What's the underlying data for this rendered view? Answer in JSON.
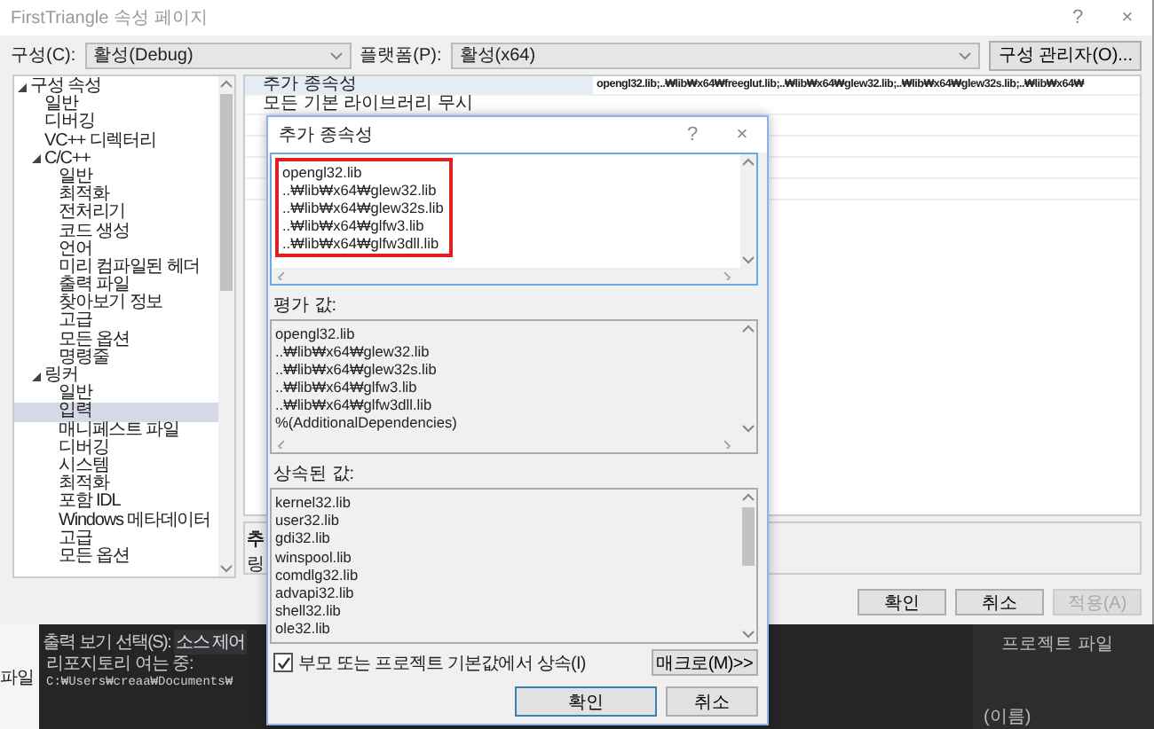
{
  "window": {
    "title": "FirstTriangle 속성 페이지",
    "help": "?",
    "close": "×"
  },
  "config": {
    "configuration_label": "구성(C):",
    "configuration": "활성(Debug)",
    "platform_label": "플랫폼(P):",
    "platform": "활성(x64)",
    "manager_button": "구성 관리자(O)..."
  },
  "tree": [
    {
      "label": "구성 속성",
      "expanded": true,
      "selected": false,
      "children": [
        {
          "label": "일반",
          "selected": false
        },
        {
          "label": "디버깅",
          "selected": false
        },
        {
          "label": "VC++ 디렉터리",
          "selected": false
        },
        {
          "label": "C/C++",
          "expanded": true,
          "selected": false,
          "children": [
            {
              "label": "일반",
              "selected": false
            },
            {
              "label": "최적화",
              "selected": false
            },
            {
              "label": "전처리기",
              "selected": false
            },
            {
              "label": "코드 생성",
              "selected": false
            },
            {
              "label": "언어",
              "selected": false
            },
            {
              "label": "미리 컴파일된 헤더",
              "selected": false
            },
            {
              "label": "출력 파일",
              "selected": false
            },
            {
              "label": "찾아보기 정보",
              "selected": false
            },
            {
              "label": "고급",
              "selected": false
            },
            {
              "label": "모든 옵션",
              "selected": false
            },
            {
              "label": "명령줄",
              "selected": false
            }
          ]
        },
        {
          "label": "링커",
          "expanded": true,
          "selected": false,
          "children": [
            {
              "label": "일반",
              "selected": false
            },
            {
              "label": "입력",
              "selected": true
            },
            {
              "label": "매니페스트 파일",
              "selected": false
            },
            {
              "label": "디버깅",
              "selected": false
            },
            {
              "label": "시스템",
              "selected": false
            },
            {
              "label": "최적화",
              "selected": false
            },
            {
              "label": "포함 IDL",
              "selected": false
            },
            {
              "label": "Windows 메타데이터",
              "selected": false
            },
            {
              "label": "고급",
              "selected": false
            },
            {
              "label": "모든 옵션",
              "selected": false
            }
          ]
        }
      ]
    }
  ],
  "grid": {
    "rows": [
      {
        "name": "추가 종속성",
        "value": "opengl32.lib;..₩lib₩x64₩freeglut.lib;..₩lib₩x64₩glew32.lib;..₩lib₩x64₩glew32s.lib;..₩lib₩x64₩",
        "selected": true
      },
      {
        "name": "모든 기본 라이브러리 무시",
        "selected": false
      }
    ]
  },
  "description": {
    "title": "추",
    "text": "링"
  },
  "buttons": [
    {
      "label": "확인",
      "disabled": false
    },
    {
      "label": "취소",
      "disabled": false
    },
    {
      "label": "적용(A)",
      "disabled": true
    }
  ],
  "output_panel": {
    "side_tab": "파일",
    "select_label": "출력 보기 선택(S):",
    "select_value": "소스 제어",
    "lines": [
      "리포지토리 여는 중:",
      "C:₩Users₩creaa₩Documents₩"
    ]
  },
  "properties_panel": {
    "item": "프로젝트 파일",
    "name_label": "(이름)"
  },
  "dialog": {
    "title": "추가 종속성",
    "help": "?",
    "close": "×",
    "edit_lines": [
      "opengl32.lib",
      "..₩lib₩x64₩glew32.lib",
      "..₩lib₩x64₩glew32s.lib",
      "..₩lib₩x64₩glfw3.lib",
      "..₩lib₩x64₩glfw3dll.lib"
    ],
    "edit_highlighted": true,
    "evaluated_label": "평가 값:",
    "evaluated_lines": [
      "opengl32.lib",
      "..₩lib₩x64₩glew32.lib",
      "..₩lib₩x64₩glew32s.lib",
      "..₩lib₩x64₩glfw3.lib",
      "..₩lib₩x64₩glfw3dll.lib",
      "%(AdditionalDependencies)"
    ],
    "inherited_label": "상속된 값:",
    "inherited_lines": [
      "kernel32.lib",
      "user32.lib",
      "gdi32.lib",
      "winspool.lib",
      "comdlg32.lib",
      "advapi32.lib",
      "shell32.lib",
      "ole32.lib"
    ],
    "inherit_checkbox": {
      "label": "부모 또는 프로젝트 기본값에서 상속(I)",
      "checked": true
    },
    "macro_button": "매크로(M)>>",
    "buttons": [
      {
        "label": "확인",
        "default": true
      },
      {
        "label": "취소",
        "default": false
      }
    ]
  }
}
